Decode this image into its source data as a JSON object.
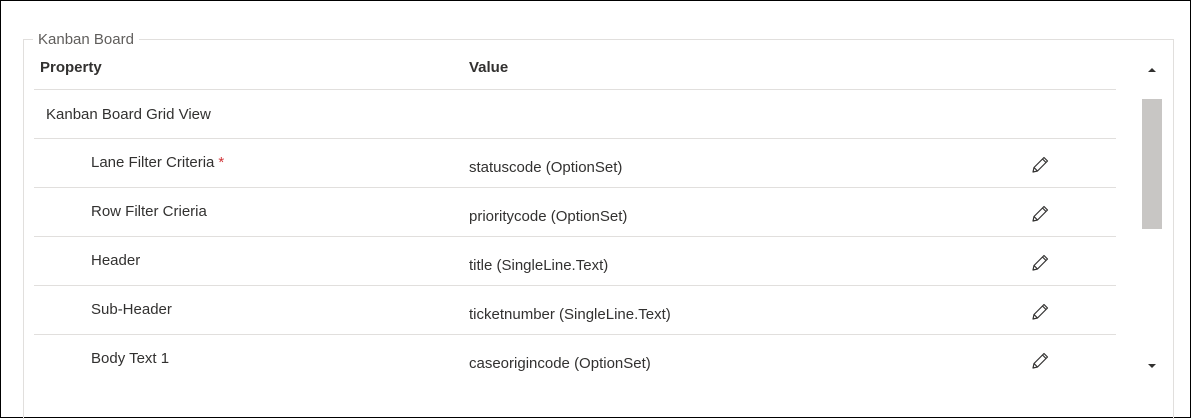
{
  "section": {
    "title": "Kanban Board"
  },
  "grid": {
    "headers": {
      "property": "Property",
      "value": "Value"
    },
    "group_label": "Kanban Board Grid View",
    "rows": [
      {
        "property": "Lane Filter Criteria",
        "required_mark": "*",
        "value": "statuscode (OptionSet)",
        "edit_icon": "pencil-icon"
      },
      {
        "property": "Row Filter Crieria",
        "value": "prioritycode (OptionSet)",
        "edit_icon": "pencil-icon"
      },
      {
        "property": "Header",
        "value": "title (SingleLine.Text)",
        "edit_icon": "pencil-icon"
      },
      {
        "property": "Sub-Header",
        "value": "ticketnumber (SingleLine.Text)",
        "edit_icon": "pencil-icon"
      },
      {
        "property": "Body Text 1",
        "value": "caseorigincode (OptionSet)",
        "edit_icon": "pencil-icon"
      }
    ]
  },
  "colors": {
    "required": "#d13438",
    "border": "#e1dfdd",
    "text": "#323130",
    "scroll_thumb": "#c8c6c4"
  }
}
